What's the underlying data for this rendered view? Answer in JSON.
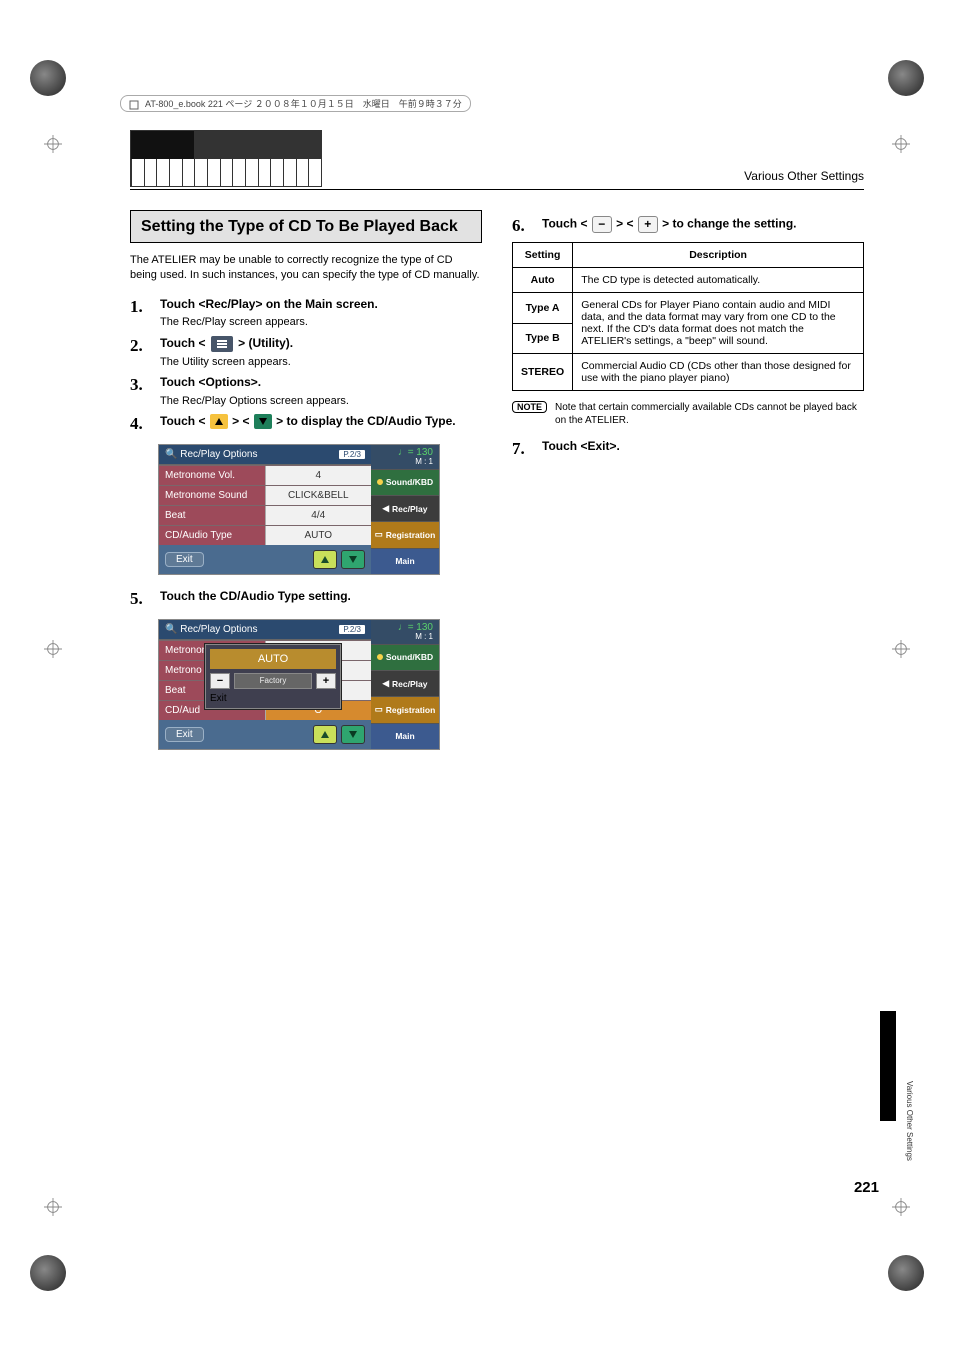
{
  "header": {
    "breadcrumb": "Various Other Settings",
    "print_note": "AT-800_e.book  221 ページ  ２００８年１０月１５日　水曜日　午前９時３７分"
  },
  "section": {
    "title": "Setting the Type of CD To Be Played Back",
    "intro": "The ATELIER may be unable to correctly recognize the type of CD being used. In such instances, you can specify the type of CD manually."
  },
  "steps": [
    {
      "num": "1.",
      "title_pre": "Touch <Rec/Play> on the Main screen.",
      "sub": "The Rec/Play screen appears."
    },
    {
      "num": "2.",
      "title_pre": "Touch < ",
      "title_post": " > (Utility).",
      "sub": "The Utility screen appears."
    },
    {
      "num": "3.",
      "title_pre": "Touch <Options>.",
      "sub": "The Rec/Play Options screen appears."
    },
    {
      "num": "4.",
      "title_pre": "Touch < ",
      "title_mid": " > < ",
      "title_post": " > to display the CD/Audio Type."
    },
    {
      "num": "5.",
      "title_pre": "Touch the CD/Audio Type setting."
    },
    {
      "num": "6.",
      "title_pre": "Touch < ",
      "title_mid": " > < ",
      "title_post": " > to change the setting."
    },
    {
      "num": "7.",
      "title_pre": "Touch <Exit>."
    }
  ],
  "screenshot": {
    "title": "Rec/Play Options",
    "page": "P.2/3",
    "tempo": "= 130",
    "measure": "M :    1",
    "rows": [
      {
        "label": "Metronome Vol.",
        "value": "4"
      },
      {
        "label": "Metronome Sound",
        "value": "CLICK&BELL"
      },
      {
        "label": "Beat",
        "value": "4/4"
      },
      {
        "label": "CD/Audio Type",
        "value": "AUTO"
      }
    ],
    "exit": "Exit",
    "side": [
      "Sound/KBD",
      "Rec/Play",
      "Registration",
      "Main"
    ],
    "popup_value": "AUTO",
    "popup_factory": "Factory"
  },
  "table": {
    "head_setting": "Setting",
    "head_desc": "Description",
    "rows": [
      {
        "setting": "Auto",
        "desc": "The CD type is detected automatically."
      },
      {
        "setting": "Type A",
        "desc": "General CDs for Player Piano contain audio and MIDI data, and the data format may vary from one CD to the next. If the CD's data format does not match the ATELIER's settings, a \"beep\" will sound.",
        "merge_with_next": true
      },
      {
        "setting": "Type B",
        "desc": ""
      },
      {
        "setting": "STEREO",
        "desc": "Commercial Audio CD (CDs other than those designed for use with the piano player piano)"
      }
    ]
  },
  "note": {
    "badge": "NOTE",
    "text": "Note that certain commercially available CDs cannot be played back on the ATELIER."
  },
  "sidebar_label": "Various Other Settings",
  "page_number": "221"
}
